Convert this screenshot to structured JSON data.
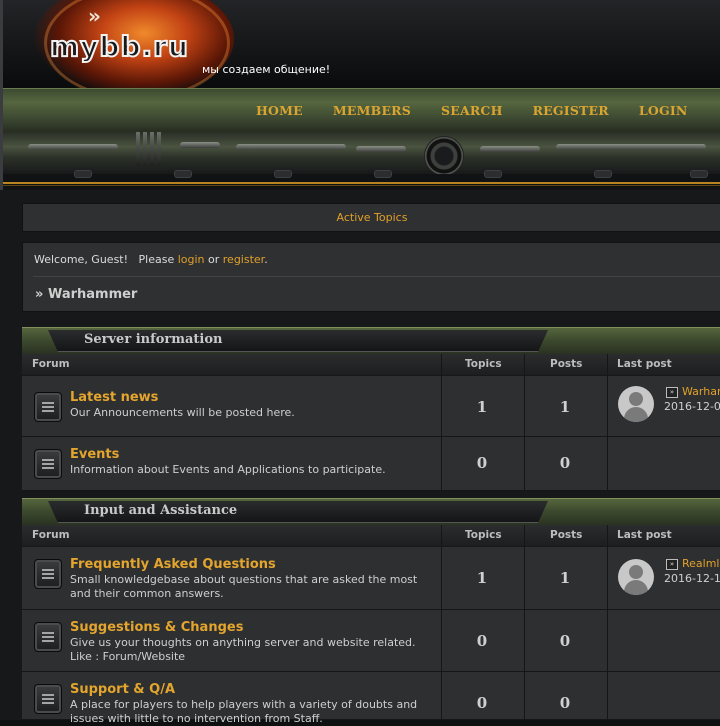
{
  "header": {
    "logo_text": "mybb.ru",
    "tagline": "мы создаем общение!",
    "nav": [
      "HOME",
      "MEMBERS",
      "SEARCH",
      "REGISTER",
      "LOGIN"
    ]
  },
  "active_topics": "Active Topics",
  "welcome": {
    "prefix": "Welcome, Guest!   Please ",
    "login": "login",
    "or": " or ",
    "register": "register",
    "suffix": "."
  },
  "breadcrumb": {
    "sep": "» ",
    "label": "Warhammer"
  },
  "columns": {
    "forum": "Forum",
    "topics": "Topics",
    "posts": "Posts",
    "last_post": "Last post"
  },
  "categories": [
    {
      "title": "Server information",
      "forums": [
        {
          "name": "Latest news",
          "desc": "Our Announcements will be posted here.",
          "topics": "1",
          "posts": "1",
          "last_link": "Warhammer",
          "last_date": "2016-12-0"
        },
        {
          "name": "Events",
          "desc": "Information about Events and Applications to participate.",
          "topics": "0",
          "posts": "0"
        }
      ]
    },
    {
      "title": "Input and Assistance",
      "forums": [
        {
          "name": "Frequently Asked Questions",
          "desc": "Small knowledgebase about questions that are asked the most and their common answers.",
          "topics": "1",
          "posts": "1",
          "last_link": "Realml",
          "last_date": "2016-12-1"
        },
        {
          "name": "Suggestions & Changes",
          "desc": "Give us your thoughts on anything server and website related. Like : Forum/Website",
          "topics": "0",
          "posts": "0"
        },
        {
          "name": "Support & Q/A",
          "desc": "A place for players to help players with a variety of doubts and issues with little to no intervention from Staff.",
          "topics": "0",
          "posts": "0"
        }
      ]
    }
  ],
  "colors": {
    "accent": "#e0a12b",
    "background": "#0f1012",
    "panel": "#2f3031",
    "category_bar": "#4a5836"
  }
}
